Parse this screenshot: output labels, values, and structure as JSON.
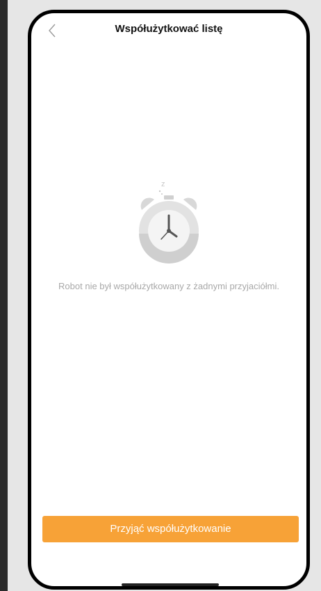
{
  "header": {
    "title": "Współużytkować listę",
    "back_icon": "chevron-left-icon"
  },
  "empty_state": {
    "icon": "alarm-clock-sleeping-icon",
    "sleep_glyph": "z",
    "message": "Robot nie był współużytkowany z żadnymi przyjaciółmi."
  },
  "actions": {
    "accept_label": "Przyjąć współużytkowanie"
  },
  "colors": {
    "accent": "#f7a237",
    "muted_text": "#a8a8a8",
    "icon_gray": "#d8d8d8"
  }
}
